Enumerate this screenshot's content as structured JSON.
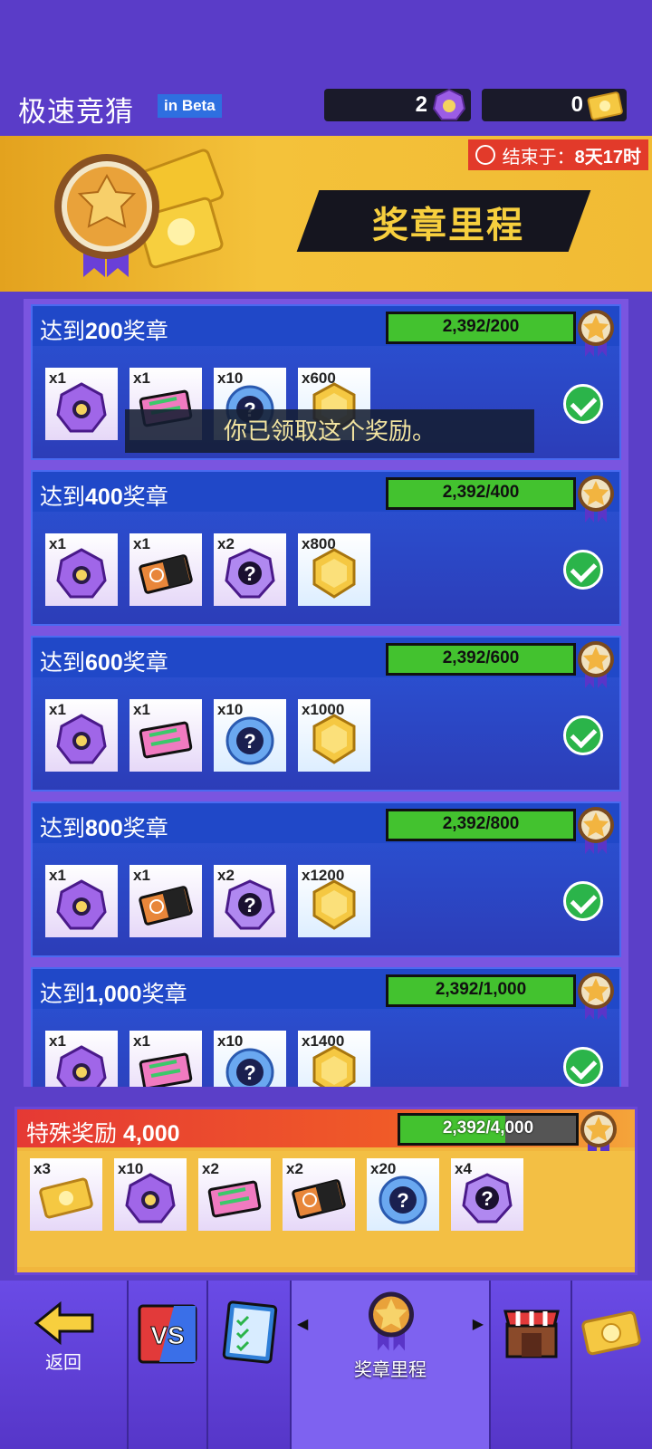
{
  "header": {
    "title": "极速竞猜",
    "beta": "in Beta",
    "gems": "2",
    "tickets": "0"
  },
  "banner": {
    "timer_prefix": "结束于：",
    "timer_value": "8天17时",
    "title": "奖章里程"
  },
  "milestones": [
    {
      "title_pre": "达到",
      "amount": "200",
      "title_post": "奖章",
      "progress": "2,392/200",
      "fill": 1.0,
      "items": [
        {
          "qty": "x1",
          "icon": "gem"
        },
        {
          "qty": "x1",
          "icon": "ticket-pink"
        },
        {
          "qty": "x10",
          "icon": "question-coin"
        },
        {
          "qty": "x600",
          "icon": "gold-hex"
        }
      ]
    },
    {
      "title_pre": "达到",
      "amount": "400",
      "title_post": "奖章",
      "progress": "2,392/400",
      "fill": 1.0,
      "items": [
        {
          "qty": "x1",
          "icon": "gem"
        },
        {
          "qty": "x1",
          "icon": "ticket-orange"
        },
        {
          "qty": "x2",
          "icon": "question-gem"
        },
        {
          "qty": "x800",
          "icon": "gold-hex"
        }
      ]
    },
    {
      "title_pre": "达到",
      "amount": "600",
      "title_post": "奖章",
      "progress": "2,392/600",
      "fill": 1.0,
      "items": [
        {
          "qty": "x1",
          "icon": "gem"
        },
        {
          "qty": "x1",
          "icon": "ticket-pink"
        },
        {
          "qty": "x10",
          "icon": "question-coin"
        },
        {
          "qty": "x1000",
          "icon": "gold-hex"
        }
      ]
    },
    {
      "title_pre": "达到",
      "amount": "800",
      "title_post": "奖章",
      "progress": "2,392/800",
      "fill": 1.0,
      "items": [
        {
          "qty": "x1",
          "icon": "gem"
        },
        {
          "qty": "x1",
          "icon": "ticket-orange"
        },
        {
          "qty": "x2",
          "icon": "question-gem"
        },
        {
          "qty": "x1200",
          "icon": "gold-hex"
        }
      ]
    },
    {
      "title_pre": "达到",
      "amount": "1,000",
      "title_post": "奖章",
      "progress": "2,392/1,000",
      "fill": 1.0,
      "items": [
        {
          "qty": "x1",
          "icon": "gem"
        },
        {
          "qty": "x1",
          "icon": "ticket-pink"
        },
        {
          "qty": "x10",
          "icon": "question-coin"
        },
        {
          "qty": "x1400",
          "icon": "gold-hex"
        }
      ]
    }
  ],
  "toast": "你已领取这个奖励。",
  "special": {
    "title": "特殊奖励",
    "amount": "4,000",
    "progress": "2,392/4,000",
    "fill": 0.598,
    "items": [
      {
        "qty": "x3",
        "icon": "gold-ticket"
      },
      {
        "qty": "x10",
        "icon": "gem"
      },
      {
        "qty": "x2",
        "icon": "ticket-pink"
      },
      {
        "qty": "x2",
        "icon": "ticket-orange"
      },
      {
        "qty": "x20",
        "icon": "question-coin"
      },
      {
        "qty": "x4",
        "icon": "question-gem"
      }
    ]
  },
  "nav": {
    "back": "返回",
    "medal_tab": "奖章里程"
  },
  "colors": {
    "progress_green": "#43c22f",
    "timer_red": "#e23a2a",
    "gold": "#f7cf3e",
    "purple_bg": "#5b3fc8"
  }
}
